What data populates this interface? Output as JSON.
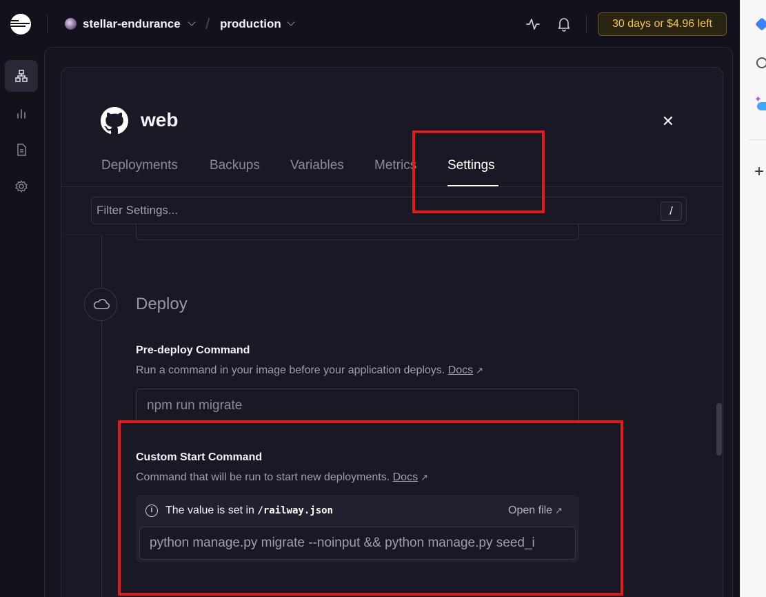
{
  "topbar": {
    "project_name": "stellar-endurance",
    "environment_name": "production",
    "trial_badge": "30 days or $4.96 left"
  },
  "service": {
    "title": "web",
    "tabs": [
      {
        "label": "Deployments"
      },
      {
        "label": "Backups"
      },
      {
        "label": "Variables"
      },
      {
        "label": "Metrics"
      },
      {
        "label": "Settings"
      }
    ],
    "active_tab": "Settings"
  },
  "filter": {
    "placeholder": "Filter Settings...",
    "shortcut": "/"
  },
  "deploy": {
    "section_title": "Deploy",
    "predeploy": {
      "label": "Pre-deploy Command",
      "description": "Run a command in your image before your application deploys.",
      "docs_link": "Docs",
      "input_placeholder": "npm run migrate"
    },
    "start_command": {
      "label": "Custom Start Command",
      "description": "Command that will be run to start new deployments.",
      "docs_link": "Docs",
      "note_prefix": "The value is set in",
      "note_file": "/railway.json",
      "open_file": "Open file",
      "value": "python manage.py migrate --noinput && python manage.py seed_i"
    }
  },
  "colors": {
    "accent_trial": "#f3c34a",
    "annotation_red": "#e01b1b",
    "background": "#13111c"
  },
  "icons": {
    "rail": [
      "architecture-icon",
      "metrics-icon",
      "logs-icon",
      "settings-icon"
    ],
    "topbar": [
      "activity-icon",
      "bell-icon"
    ]
  }
}
